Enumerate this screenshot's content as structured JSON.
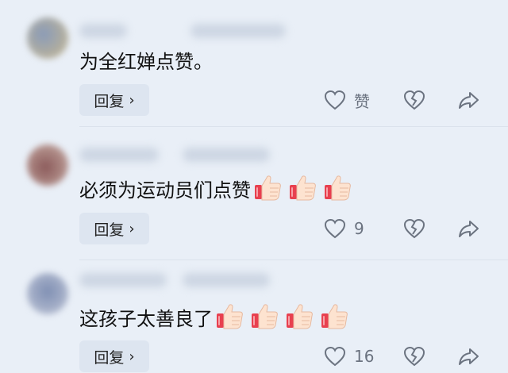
{
  "comments": [
    {
      "text": "为全红婵点赞。",
      "thumbs": 0,
      "reply_label": "回复",
      "like_label": "赞"
    },
    {
      "text": "必须为运动员们点赞",
      "thumbs": 3,
      "reply_label": "回复",
      "like_label": "9"
    },
    {
      "text": "这孩子太善良了",
      "thumbs": 4,
      "reply_label": "回复",
      "like_label": "16"
    }
  ],
  "colors": {
    "background": "#e9eff7",
    "icon": "#6b7380",
    "reply_bg": "#dde5f0"
  },
  "icons": [
    "heart-outline-icon",
    "broken-heart-icon",
    "share-arrow-icon",
    "thumbs-up-emoji"
  ]
}
